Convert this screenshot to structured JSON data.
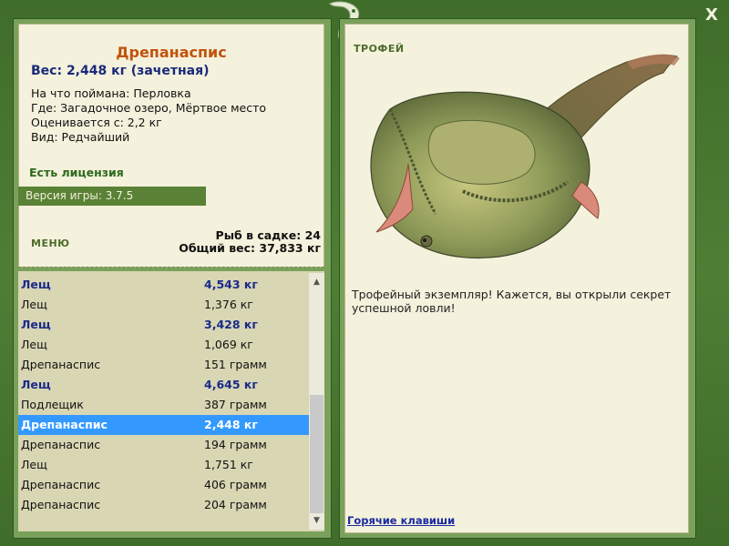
{
  "window": {
    "close_label": "X"
  },
  "fish": {
    "title": "Дрепанаспис",
    "weight_line": "Вес: 2,448 кг (зачетная)",
    "caught_with": "На что поймана: Перловка",
    "location": "Где: Загадочное озеро, Мёртвое место",
    "valued_from": "Оценивается с: 2,2 кг",
    "rarity": "Вид: Редчайший"
  },
  "license": "Есть лицензия",
  "version": "Версия игры: 3.7.5",
  "menu_label": "МЕНЮ",
  "stats": {
    "fish_in_keepnet": "Рыб в садке: 24",
    "total_weight": "Общий вес: 37,833 кг"
  },
  "catch_list": [
    {
      "name": "Лещ",
      "weight": "4,543 кг",
      "style": "bold"
    },
    {
      "name": "Лещ",
      "weight": "1,376 кг",
      "style": "normal"
    },
    {
      "name": "Лещ",
      "weight": "3,428 кг",
      "style": "bold"
    },
    {
      "name": "Лещ",
      "weight": "1,069 кг",
      "style": "normal"
    },
    {
      "name": "Дрепанаспис",
      "weight": "151 грамм",
      "style": "normal"
    },
    {
      "name": "Лещ",
      "weight": "4,645 кг",
      "style": "bold"
    },
    {
      "name": "Подлещик",
      "weight": "387 грамм",
      "style": "normal"
    },
    {
      "name": "Дрепанаспис",
      "weight": "2,448 кг",
      "style": "selected"
    },
    {
      "name": "Дрепанаспис",
      "weight": "194 грамм",
      "style": "normal"
    },
    {
      "name": "Лещ",
      "weight": "1,751 кг",
      "style": "normal"
    },
    {
      "name": "Дрепанаспис",
      "weight": "406 грамм",
      "style": "normal"
    },
    {
      "name": "Дрепанаспис",
      "weight": "204 грамм",
      "style": "normal"
    }
  ],
  "trophy": {
    "label": "ТРОФЕЙ",
    "text": "Трофейный экземпляр! Кажется, вы открыли секрет успешной ловли!"
  },
  "hotkeys_label": "Горячие клавиши",
  "colors": {
    "frame_green": "#4b7a33",
    "title_orange": "#c2520c",
    "link_blue": "#1a2aa0",
    "selected_blue": "#3399ff"
  }
}
